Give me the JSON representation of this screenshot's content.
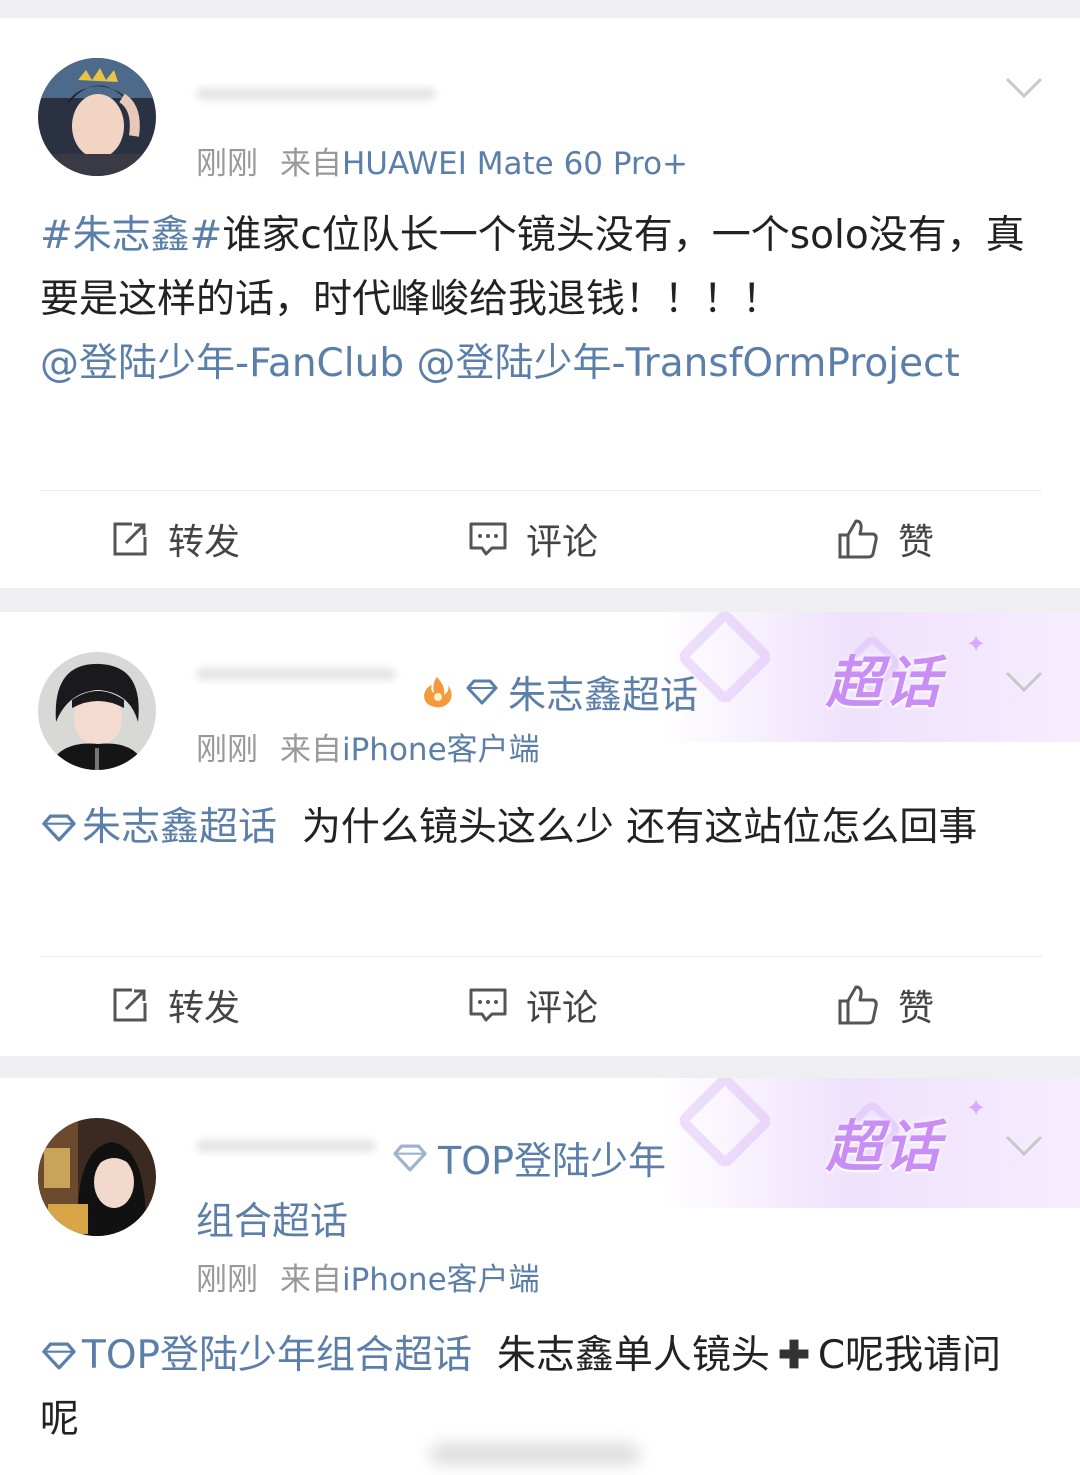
{
  "colors": {
    "link": "#5b7fa8",
    "meta": "#999999",
    "text": "#222222",
    "banner_text": "#c98ef5",
    "background": "#efeff1"
  },
  "actions": {
    "repost_label": "转发",
    "comment_label": "评论",
    "like_label": "赞"
  },
  "posts": [
    {
      "time": "刚刚",
      "from_prefix": "来自",
      "source": "HUAWEI Mate 60 Pro+",
      "content": {
        "hashtag": "#朱志鑫#",
        "text": "谁家c位队长一个镜头没有，一个solo没有，真要是这样的话，时代峰峻给我退钱！！！！",
        "mention1": "@登陆少年-FanClub",
        "mention2": "@登陆少年-TransfOrmProject"
      }
    },
    {
      "topic_badge": "朱志鑫超话",
      "banner_text": "超话",
      "time": "刚刚",
      "from_prefix": "来自",
      "source": "iPhone客户端",
      "content": {
        "topic": "朱志鑫超话",
        "text": "为什么镜头这么少 还有这站位怎么回事"
      }
    },
    {
      "topic_badge_line1": "TOP登陆少年",
      "topic_badge_line2": "组合超话",
      "banner_text": "超话",
      "time": "刚刚",
      "from_prefix": "来自",
      "source": "iPhone客户端",
      "content": {
        "topic": "TOP登陆少年组合超话",
        "text_part1": "朱志鑫单人镜头",
        "plus_icon": "plus-icon",
        "text_part2": "C呢我请问呢"
      }
    }
  ]
}
